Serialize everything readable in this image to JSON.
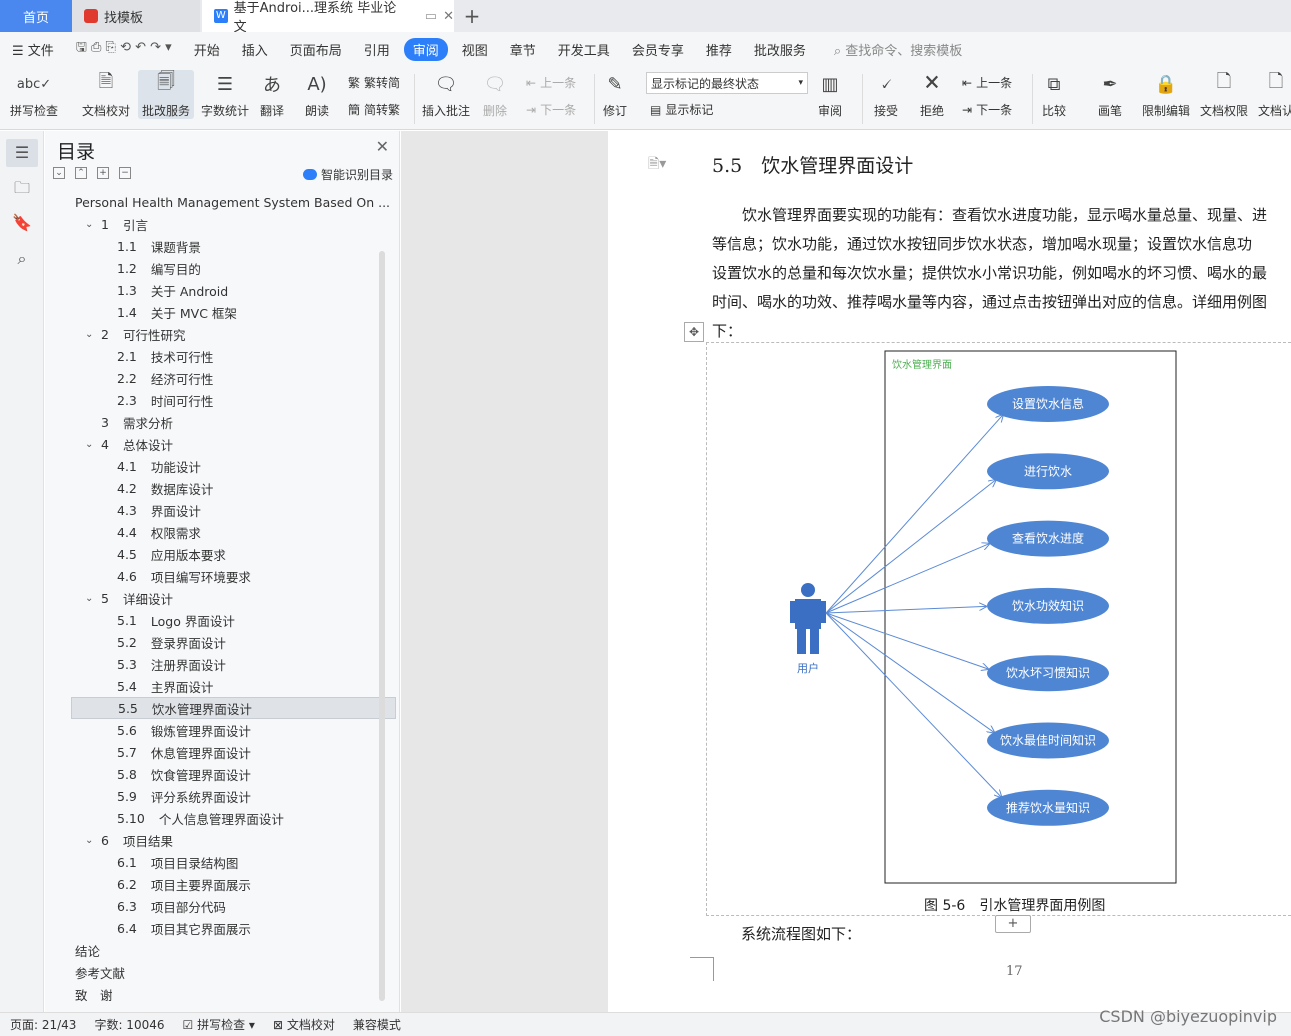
{
  "tabs": {
    "home": "首页",
    "zhaomoban": "找模板",
    "doc": "基于Androi...理系统 毕业论文"
  },
  "menu": [
    "文件",
    "开始",
    "插入",
    "页面布局",
    "引用",
    "审阅",
    "视图",
    "章节",
    "开发工具",
    "会员专享",
    "推荐",
    "批改服务"
  ],
  "menu_active": "审阅",
  "search_cmd": "查找命令、搜索模板",
  "ribbon": {
    "spell": "拼写检查",
    "proof": "文档校对",
    "correct": "批改服务",
    "count": "字数统计",
    "translate": "翻译",
    "read": "朗读",
    "trad": "繁转简",
    "simp": "简转繁",
    "insert_comment": "插入批注",
    "delete": "删除",
    "prev": "上一条",
    "next": "下一条",
    "revise": "修订",
    "final_state": "显示标记的最终状态",
    "show_marks": "显示标记",
    "review": "审阅",
    "accept": "接受",
    "reject": "拒绝",
    "prev2": "上一条",
    "next2": "下一条",
    "compare": "比较",
    "pen": "画笔",
    "restrict": "限制编辑",
    "perm": "文档权限",
    "doc_more": "文档认"
  },
  "toc": {
    "title": "目录",
    "ai": "智能识别目录",
    "items": [
      {
        "lv": 0,
        "num": "",
        "text": "Personal Health Management System Based On ..."
      },
      {
        "lv": 1,
        "num": "1",
        "text": "引言",
        "arrow": true
      },
      {
        "lv": 2,
        "num": "1.1",
        "text": "课题背景"
      },
      {
        "lv": 2,
        "num": "1.2",
        "text": "编写目的"
      },
      {
        "lv": 2,
        "num": "1.3",
        "text": "关于 Android"
      },
      {
        "lv": 2,
        "num": "1.4",
        "text": "关于 MVC 框架"
      },
      {
        "lv": 1,
        "num": "2",
        "text": "可行性研究",
        "arrow": true
      },
      {
        "lv": 2,
        "num": "2.1",
        "text": "技术可行性"
      },
      {
        "lv": 2,
        "num": "2.2",
        "text": "经济可行性"
      },
      {
        "lv": 2,
        "num": "2.3",
        "text": "时间可行性"
      },
      {
        "lv": 1,
        "num": "3",
        "text": "需求分析"
      },
      {
        "lv": 1,
        "num": "4",
        "text": "总体设计",
        "arrow": true
      },
      {
        "lv": 2,
        "num": "4.1",
        "text": "功能设计"
      },
      {
        "lv": 2,
        "num": "4.2",
        "text": "数据库设计"
      },
      {
        "lv": 2,
        "num": "4.3",
        "text": "界面设计"
      },
      {
        "lv": 2,
        "num": "4.4",
        "text": "权限需求"
      },
      {
        "lv": 2,
        "num": "4.5",
        "text": "应用版本要求"
      },
      {
        "lv": 2,
        "num": "4.6",
        "text": "项目编写环境要求"
      },
      {
        "lv": 1,
        "num": "5",
        "text": "详细设计",
        "arrow": true
      },
      {
        "lv": 2,
        "num": "5.1",
        "text": "Logo 界面设计"
      },
      {
        "lv": 2,
        "num": "5.2",
        "text": "登录界面设计"
      },
      {
        "lv": 2,
        "num": "5.3",
        "text": "注册界面设计"
      },
      {
        "lv": 2,
        "num": "5.4",
        "text": "主界面设计"
      },
      {
        "lv": 2,
        "num": "5.5",
        "text": "饮水管理界面设计",
        "selected": true
      },
      {
        "lv": 2,
        "num": "5.6",
        "text": "锻炼管理界面设计"
      },
      {
        "lv": 2,
        "num": "5.7",
        "text": "休息管理界面设计"
      },
      {
        "lv": 2,
        "num": "5.8",
        "text": "饮食管理界面设计"
      },
      {
        "lv": 2,
        "num": "5.9",
        "text": "评分系统界面设计"
      },
      {
        "lv": 2,
        "num": "5.10",
        "text": "个人信息管理界面设计"
      },
      {
        "lv": 1,
        "num": "6",
        "text": "项目结果",
        "arrow": true
      },
      {
        "lv": 2,
        "num": "6.1",
        "text": "项目目录结构图"
      },
      {
        "lv": 2,
        "num": "6.2",
        "text": "项目主要界面展示"
      },
      {
        "lv": 2,
        "num": "6.3",
        "text": "项目部分代码"
      },
      {
        "lv": 2,
        "num": "6.4",
        "text": "项目其它界面展示"
      },
      {
        "lv": 0,
        "num": "",
        "text": "结论"
      },
      {
        "lv": 0,
        "num": "",
        "text": "参考文献"
      },
      {
        "lv": 0,
        "num": "",
        "text": "致　谢"
      }
    ]
  },
  "doc": {
    "heading": "5.5　饮水管理界面设计",
    "para_lines": [
      "　　饮水管理界面要实现的功能有：查看饮水进度功能，显示喝水量总量、现量、进",
      "等信息；饮水功能，通过饮水按钮同步饮水状态，增加喝水现量；设置饮水信息功",
      "设置饮水的总量和每次饮水量；提供饮水小常识功能，例如喝水的坏习惯、喝水的最",
      "时间、喝水的功效、推荐喝水量等内容，通过点击按钮弹出对应的信息。详细用例图",
      "下："
    ],
    "diagram": {
      "frame_label": "饮水管理界面",
      "actor": "用户",
      "usecases": [
        "设置饮水信息",
        "进行饮水",
        "查看饮水进度",
        "饮水功效知识",
        "饮水坏习惯知识",
        "饮水最佳时间知识",
        "推荐饮水量知识"
      ]
    },
    "caption": "图 5-6　引水管理界面用例图",
    "flow_text": "系统流程图如下：",
    "page_number": "17"
  },
  "status": {
    "page": "页面: 21/43",
    "words": "字数: 10046",
    "spell": "拼写检查",
    "proof": "文档校对",
    "compat": "兼容模式"
  },
  "watermark": "CSDN @biyezuopinvip"
}
